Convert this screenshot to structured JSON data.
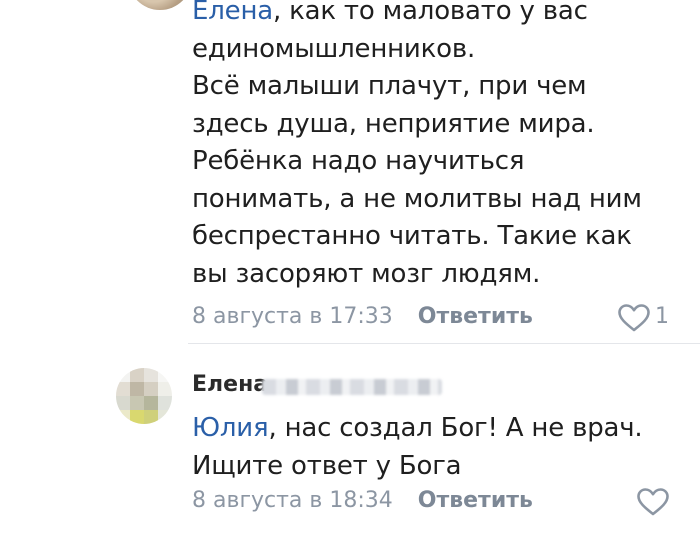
{
  "comment1": {
    "lines": [
      {
        "mention": "Елена",
        "text": ", как то маловато у вас"
      },
      {
        "text": "единомышленников."
      },
      {
        "text": "Всё малыши плачут, при чем"
      },
      {
        "text": "здесь душа, неприятие мира."
      },
      {
        "text": "Ребёнка надо научиться"
      },
      {
        "text": "понимать, а не молитвы над ним"
      },
      {
        "text": "беспрестанно читать. Такие как"
      },
      {
        "text": "вы засоряют мозг людям."
      }
    ],
    "date": "8 августа в 17:33",
    "reply_label": "Ответить",
    "like_count": "1"
  },
  "comment2": {
    "author": "Елена",
    "lines": [
      {
        "mention": "Юлия",
        "text": ", нас создал Бог! А не врач."
      },
      {
        "text": "Ищите ответ у Бога"
      }
    ],
    "date": "8 августа в 18:34",
    "reply_label": "Ответить"
  },
  "colors": {
    "mention": "#2a5fa8",
    "meta_gray": "#8c96a3",
    "text": "#1f1f1f"
  },
  "icons": {
    "like": "heart-outline-icon"
  }
}
